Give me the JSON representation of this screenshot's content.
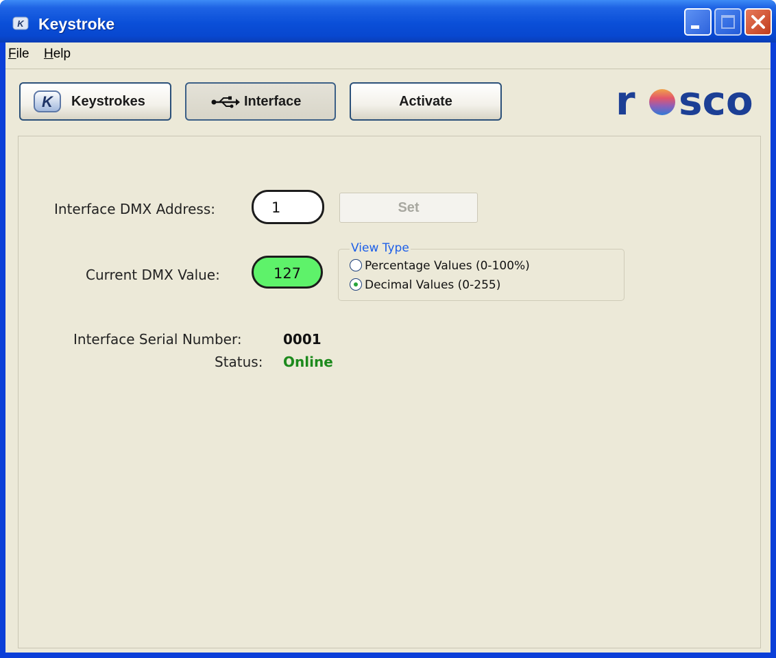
{
  "window": {
    "title": "Keystroke",
    "title_bar_color": "#0a4fd8",
    "close_color": "#d24b2b"
  },
  "menu": {
    "items": [
      {
        "label": "File",
        "mnemonic": "F",
        "rest": "ile"
      },
      {
        "label": "Help",
        "mnemonic": "H",
        "rest": "elp"
      }
    ]
  },
  "toolbar": {
    "keystrokes_label": "Keystrokes",
    "interface_label": "Interface",
    "activate_label": "Activate",
    "active_tab": "Interface"
  },
  "logo": {
    "text": "rosco",
    "color": "#1c3f95"
  },
  "interface": {
    "dmx_address_label": "Interface DMX Address:",
    "dmx_address_value": "1",
    "set_label": "Set",
    "set_enabled": false,
    "current_value_label": "Current DMX Value:",
    "current_value": "127",
    "value_color": "#5ef26a",
    "view_type": {
      "title": "View Type",
      "options": [
        {
          "label": "Percentage Values (0-100%)",
          "selected": false
        },
        {
          "label": "Decimal Values (0-255)",
          "selected": true
        }
      ]
    },
    "serial_label": "Interface Serial Number:",
    "serial_value": "0001",
    "status_label": "Status:",
    "status_value": "Online",
    "status_color": "#1d8a1d"
  }
}
